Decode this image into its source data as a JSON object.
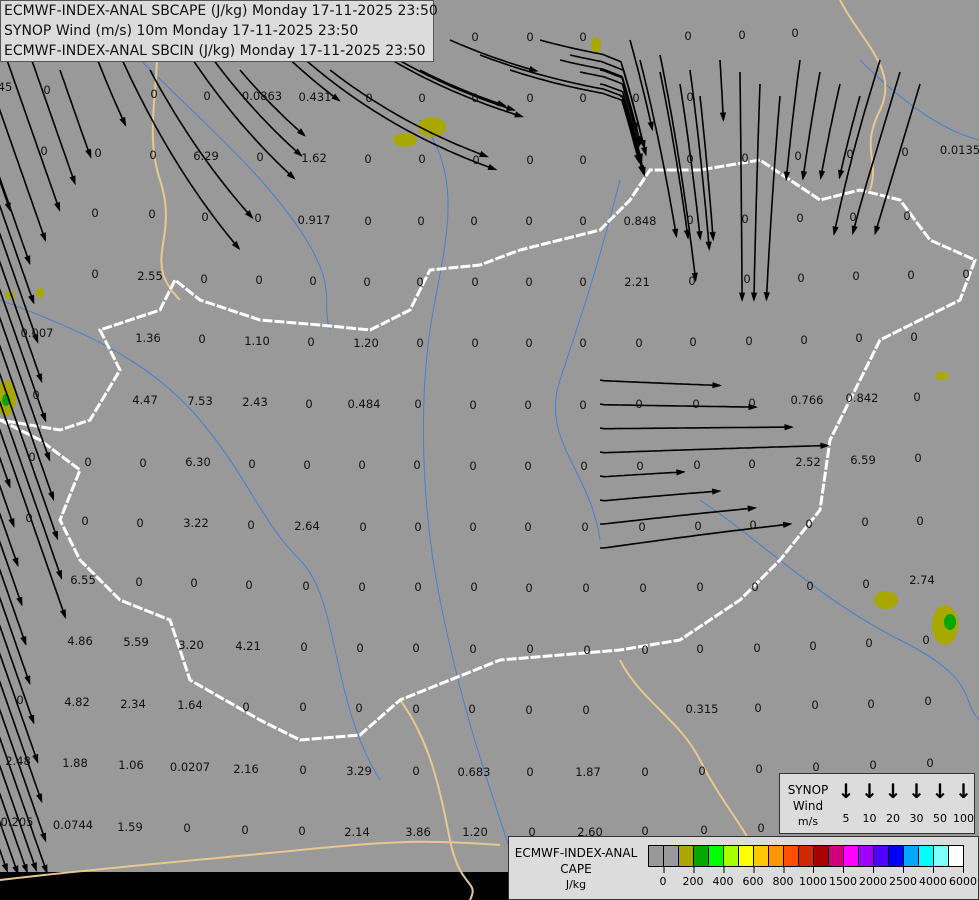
{
  "title_box": {
    "lines": [
      "ECMWF-INDEX-ANAL SBCAPE (J/kg) Monday 17-11-2025 23:50",
      "SYNOP Wind (m/s) 10m Monday 17-11-2025 23:50",
      "ECMWF-INDEX-ANAL SBCIN (J/kg) Monday 17-11-2025 23:50"
    ]
  },
  "wind_legend": {
    "title": "SYNOP",
    "subtitle": "Wind",
    "unit": "m/s",
    "speeds": [
      "5",
      "10",
      "20",
      "30",
      "50",
      "100"
    ],
    "arrow_icon": "↓"
  },
  "cape_legend": {
    "title": "ECMWF-INDEX-ANAL",
    "subtitle": "CAPE",
    "unit": "J/kg",
    "colors": [
      "#999999",
      "#999999",
      "#a8a800",
      "#00a800",
      "#00ff00",
      "#a8ff00",
      "#ffff00",
      "#ffc800",
      "#ff9600",
      "#ff5000",
      "#d22800",
      "#aa0000",
      "#d2007a",
      "#ff00ff",
      "#a000ff",
      "#5000ff",
      "#0000ff",
      "#00a8ff",
      "#00ffff",
      "#80ffff",
      "#ffffff"
    ],
    "ticks": [
      "0",
      "200",
      "400",
      "600",
      "800",
      "1000",
      "1500",
      "2000",
      "2500",
      "4000",
      "6000"
    ]
  },
  "map": {
    "background": "#999999",
    "streamline_color": "#000000",
    "border_color": "#ffffff",
    "cape_values": [
      "45",
      "0",
      "0",
      "0",
      "0.0863",
      "0.431",
      "0",
      "0",
      "0",
      "0",
      "0",
      "0",
      "0",
      "0",
      "0",
      "0",
      "0",
      "0",
      "0",
      "0",
      "0",
      "0",
      "6.29",
      "0",
      "1.62",
      "0",
      "0",
      "0",
      "0",
      "0",
      "0",
      "0",
      "0",
      "0",
      "0",
      "0.0135",
      "0",
      "0",
      "0",
      "0",
      "0.917",
      "0",
      "0",
      "0",
      "0",
      "0",
      "0.848",
      "0",
      "0",
      "0",
      "0",
      "0",
      "0",
      "2.55",
      "0",
      "0",
      "0",
      "0",
      "0",
      "0",
      "0",
      "0",
      "2.21",
      "0",
      "0",
      "0",
      "0",
      "0",
      "0",
      "0.007",
      "1.36",
      "0",
      "1.10",
      "0",
      "1.20",
      "0",
      "0",
      "0",
      "0",
      "0",
      "0",
      "0",
      "0",
      "0",
      "0",
      "0",
      "4.47",
      "7.53",
      "2.43",
      "0",
      "0.484",
      "0",
      "0",
      "0",
      "0",
      "0",
      "0",
      "0",
      "0.766",
      "0.842",
      "0",
      "0",
      "0",
      "0",
      "6.30",
      "0",
      "0",
      "0",
      "0",
      "0",
      "0",
      "0",
      "0",
      "0",
      "0",
      "2.52",
      "6.59",
      "0",
      "0",
      "0",
      "0",
      "3.22",
      "0",
      "2.64",
      "0",
      "0",
      "0",
      "0",
      "0",
      "0",
      "0",
      "0",
      "0",
      "0",
      "0",
      "6.55",
      "0",
      "0",
      "0",
      "0",
      "0",
      "0",
      "0",
      "0",
      "0",
      "0",
      "0",
      "0",
      "0",
      "0",
      "2.74",
      "4.86",
      "5.59",
      "3.20",
      "4.21",
      "0",
      "0",
      "0",
      "0",
      "0",
      "0",
      "0",
      "0",
      "0",
      "0",
      "0",
      "0",
      "0",
      "4.82",
      "2.34",
      "1.64",
      "0",
      "0",
      "0",
      "0",
      "0",
      "0",
      "0",
      "0.315",
      "0",
      "0",
      "0",
      "0",
      "2.48",
      "1.88",
      "1.06",
      "0.0207",
      "2.16",
      "0",
      "3.29",
      "0",
      "0.683",
      "0",
      "1.87",
      "0",
      "0",
      "0",
      "0",
      "0",
      "0",
      "0.205",
      "0.0744",
      "1.59",
      "0",
      "0",
      "0",
      "2.14",
      "3.86",
      "1.20",
      "0",
      "2.60",
      "0",
      "0",
      "0"
    ]
  }
}
